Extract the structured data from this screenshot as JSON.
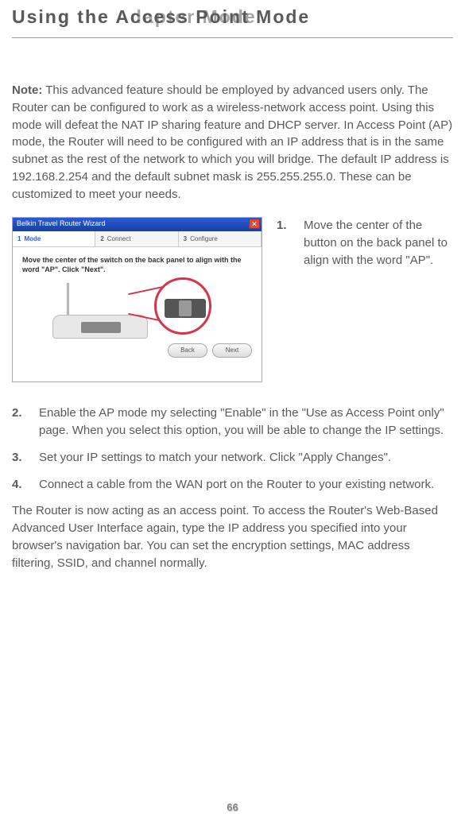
{
  "header": {
    "title_back": "Using the Adapter Mode",
    "title_front": "Using the Access Point Mode"
  },
  "note": {
    "label": "Note:",
    "body": "This advanced feature should be employed by advanced users only. The Router can be configured to work as a wireless-network access point. Using this mode will defeat the NAT IP sharing feature and DHCP server. In Access Point (AP) mode, the Router will need to be configured with an IP address that is in the same subnet as the rest of the network to which you will bridge. The default IP address is 192.168.2.254 and the default subnet mask is 255.255.255.0. These can be customized to meet your needs."
  },
  "wizard": {
    "window_title": "Belkin Travel Router Wizard",
    "tabs": [
      {
        "num": "1",
        "label": "Mode"
      },
      {
        "num": "2",
        "label": "Connect"
      },
      {
        "num": "3",
        "label": "Configure"
      }
    ],
    "instruction": "Move the center of the switch on the back panel to align with the word \"AP\". Click \"Next\".",
    "back_btn": "Back",
    "next_btn": "Next"
  },
  "steps": {
    "s1": {
      "num": "1.",
      "text": "Move the center of the button on the back panel to align with the word \"AP\"."
    },
    "s2": {
      "num": "2.",
      "text": "Enable the AP mode my selecting \"Enable\" in the \"Use as Access Point only\" page. When you select this option, you will be able to change the IP settings."
    },
    "s3": {
      "num": "3.",
      "text": "Set your IP settings to match your network. Click \"Apply Changes\"."
    },
    "s4": {
      "num": "4.",
      "text": "Connect a cable from the WAN port on the Router to your existing network."
    }
  },
  "closing": "The Router is now acting as an access point. To access the Router's Web-Based Advanced User Interface again, type the IP address you specified into your browser's navigation bar. You can set the encryption settings, MAC address filtering, SSID, and channel normally.",
  "page_number": "66"
}
